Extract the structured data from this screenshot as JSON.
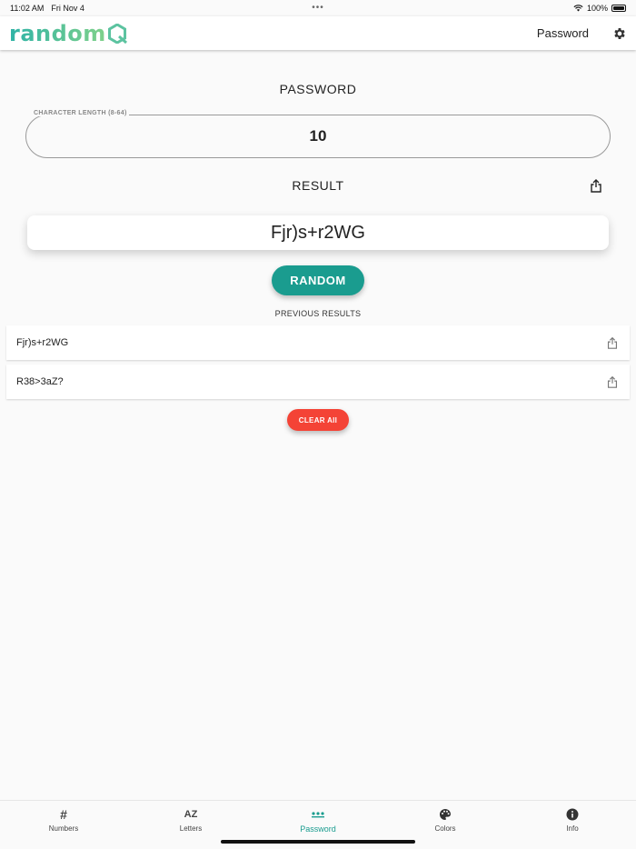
{
  "status_bar": {
    "time": "11:02 AM",
    "date": "Fri Nov 4",
    "battery": "100%"
  },
  "header": {
    "logo_text": "random",
    "title": "Password"
  },
  "password_section": {
    "title": "PASSWORD",
    "length_label": "CHARACTER LENGTH (8-64)",
    "length_value": "10"
  },
  "result_section": {
    "title": "RESULT",
    "value": "Fjr)s+r2WG"
  },
  "random_button": "RANDOM",
  "previous": {
    "title": "PREVIOUS RESULTS",
    "items": [
      "Fjr)s+r2WG",
      "R38>3aZ?"
    ]
  },
  "clear_button": "CLEAR All",
  "tabs": [
    {
      "label": "Numbers",
      "icon": "hash-icon"
    },
    {
      "label": "Letters",
      "icon": "az-icon",
      "glyph": "AZ"
    },
    {
      "label": "Password",
      "icon": "dots-icon",
      "active": true
    },
    {
      "label": "Colors",
      "icon": "palette-icon"
    },
    {
      "label": "Info",
      "icon": "info-icon"
    }
  ],
  "colors": {
    "accent": "#1a9c8f",
    "danger": "#f44336"
  }
}
